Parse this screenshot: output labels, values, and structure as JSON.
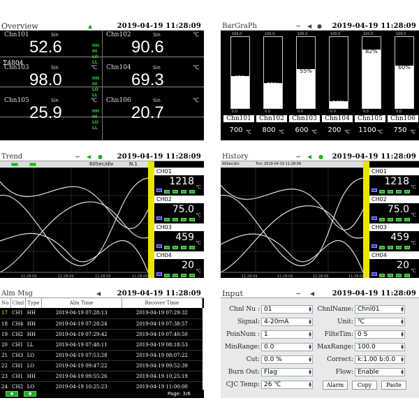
{
  "overview": {
    "title": "Overview",
    "datetime": "2019-04-19    11:28:09",
    "sum_label": "Σ4804",
    "alarm_labels": [
      "HH",
      "HI",
      "LO",
      "LL"
    ],
    "channels": [
      {
        "name": "Chn101",
        "signal": "Sin",
        "unit": "",
        "value": "52.6"
      },
      {
        "name": "Chn102",
        "signal": "Sin",
        "unit": "℃",
        "value": "90.6"
      },
      {
        "name": "Chn103",
        "signal": "Sin",
        "unit": "℃",
        "value": "98.0"
      },
      {
        "name": "Chn104",
        "signal": "Sin",
        "unit": "℃",
        "value": "69.3"
      },
      {
        "name": "Chn105",
        "signal": "Sin",
        "unit": "℃",
        "value": "25.9"
      },
      {
        "name": "Chn106",
        "signal": "Sin",
        "unit": "℃",
        "value": "20.7"
      }
    ]
  },
  "bargraph": {
    "title": "BarGraPh",
    "datetime": "2019-04-19    11:28:09",
    "scale_top": "100.0",
    "scale_bottom": "0.0",
    "bars": [
      {
        "name": "Chn101",
        "percent": 45,
        "label": "45%",
        "value": "700",
        "unit": "℃"
      },
      {
        "name": "Chn102",
        "percent": 35,
        "label": "35%",
        "value": "800",
        "unit": "℃"
      },
      {
        "name": "Chn103",
        "percent": 55,
        "label": "55%",
        "value": "600",
        "unit": "℃"
      },
      {
        "name": "Chn104",
        "percent": 10,
        "label": "10%",
        "value": "200",
        "unit": "℃"
      },
      {
        "name": "Chn105",
        "percent": 82,
        "label": "82%",
        "value": "1100",
        "unit": "℃"
      },
      {
        "name": "Chn106",
        "percent": 60,
        "label": "60%",
        "value": "750",
        "unit": "℃"
      }
    ]
  },
  "trend": {
    "title": "Trend",
    "datetime": "2019-04-19    11:28:09",
    "scale": "60Sec/div",
    "page": "N.1",
    "time_labels": [
      "11:28:09",
      "11:28:09",
      "11:28:09",
      "11:28:09"
    ],
    "channels": [
      {
        "name": "CH01",
        "value": "1218",
        "unit": "℃"
      },
      {
        "name": "CH02",
        "value": "75.0",
        "unit": "℃"
      },
      {
        "name": "CH03",
        "value": "459",
        "unit": "℃"
      },
      {
        "name": "CH04",
        "value": "20",
        "unit": "℃"
      }
    ]
  },
  "history": {
    "title": "History",
    "datetime": "2019-04-19    11:28:09",
    "scale": "60Sec/div",
    "time_prefix": "Tim:",
    "time_text": "2019-04-19   11:28:09",
    "time_labels": [
      "11:28:09",
      "11:28:09",
      "11:28:09",
      "11:28:09"
    ],
    "channels": [
      {
        "name": "CH01",
        "value": "1218",
        "unit": "℃"
      },
      {
        "name": "CH02",
        "value": "75.0",
        "unit": "℃"
      },
      {
        "name": "CH03",
        "value": "459",
        "unit": "℃"
      },
      {
        "name": "CH04",
        "value": "20",
        "unit": "℃"
      }
    ]
  },
  "alarm": {
    "title": "Alm Msg",
    "datetime": "2019-04-19    11:28:09",
    "headers": [
      "Nu",
      "Chnl",
      "Type",
      "Alm Time",
      "Recover Time"
    ],
    "rows": [
      {
        "nu": "17",
        "ch": "CH1",
        "type": "HH",
        "alm": "2019-04-19   07:28:13",
        "rec": "2019-04-19   07:29:32"
      },
      {
        "nu": "18",
        "ch": "CH4",
        "type": "HH",
        "alm": "2019-04-19   07:28:24",
        "rec": "2019-04-19   07:38:57"
      },
      {
        "nu": "19",
        "ch": "CH2",
        "type": "HH",
        "alm": "2019-04-19   07:29:42",
        "rec": "2019-04-19   07:40:50"
      },
      {
        "nu": "20",
        "ch": "CH1",
        "type": "LL",
        "alm": "2019-04-19   07:48:11",
        "rec": "2019-04-19   08:18:53"
      },
      {
        "nu": "21",
        "ch": "CH3",
        "type": "LO",
        "alm": "2019-04-19   07:53:28",
        "rec": "2019-04-19   08:07:22"
      },
      {
        "nu": "22",
        "ch": "CH1",
        "type": "LO",
        "alm": "2019-04-19   09:47:22",
        "rec": "2019-04-19   09:52:39"
      },
      {
        "nu": "23",
        "ch": "CH1",
        "type": "HH",
        "alm": "2019-04-19   09:55:26",
        "rec": "2019-04-19   10:25:19"
      },
      {
        "nu": "24",
        "ch": "CH2",
        "type": "LO",
        "alm": "2019-04-19   10:25:23",
        "rec": "2019-04-19   11:00:00"
      }
    ],
    "page": "Page:  3/6"
  },
  "input": {
    "title": "Input",
    "datetime": "2019-04-19    11:28:09",
    "left_fields": [
      {
        "label": "Chnl Nu :",
        "value": "01"
      },
      {
        "label": "Signal:",
        "value": "4-20mA"
      },
      {
        "label": "PoinNum :",
        "value": "1"
      },
      {
        "label": "MinRange:",
        "value": "0.0"
      },
      {
        "label": "Cut:",
        "value": "0.0  %"
      },
      {
        "label": "Burn Out:",
        "value": "Flag"
      },
      {
        "label": "CJC Temp:",
        "value": "26 ℃"
      }
    ],
    "right_fields": [
      {
        "label": "ChnlName:",
        "value": "Chnl01"
      },
      {
        "label": "Unit:",
        "value": "℃"
      },
      {
        "label": "FilteTim:",
        "value": "0 S"
      },
      {
        "label": "MaxRange:",
        "value": "100.0"
      },
      {
        "label": "Correct:",
        "value": "k:1.00  b:0.0"
      },
      {
        "label": "Flow:",
        "value": "Enable"
      }
    ],
    "buttons": [
      "Alarm",
      "Copy",
      "Paste"
    ]
  },
  "colors": {
    "alarm_green": "#33cc33",
    "bar_yellow": "#e8e20f",
    "panel_black": "#000000"
  }
}
